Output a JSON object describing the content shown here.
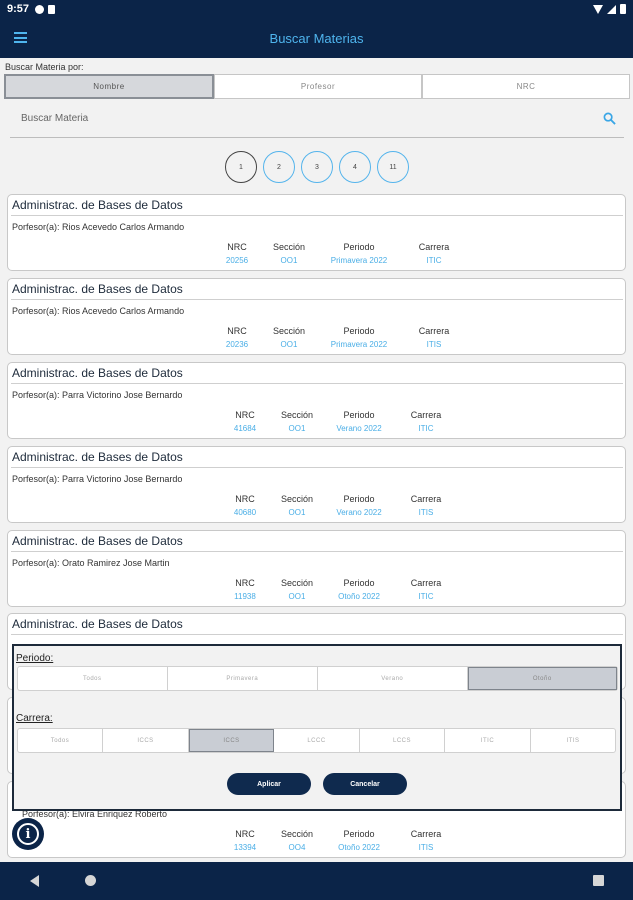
{
  "status": {
    "time": "9:57"
  },
  "appbar": {
    "title": "Buscar Materias"
  },
  "search": {
    "by_label": "Buscar Materia por:",
    "options": [
      "Nombre",
      "Profesor",
      "NRC"
    ],
    "placeholder": "Buscar Materia"
  },
  "pagination": [
    "1",
    "2",
    "3",
    "4",
    "11"
  ],
  "cards": [
    {
      "title": "Administrac. de Bases de Datos",
      "prof": "Porfesor(a): Rios Acevedo Carlos Armando",
      "h_nrc": "NRC",
      "h_seccion": "Sección",
      "h_periodo": "Periodo",
      "h_carrera": "Carrera",
      "nrc": "20256",
      "seccion": "OO1",
      "periodo": "Primavera 2022",
      "carrera": "ITIC"
    },
    {
      "title": "Administrac. de Bases de Datos",
      "prof": "Porfesor(a): Rios Acevedo Carlos Armando",
      "h_nrc": "NRC",
      "h_seccion": "Sección",
      "h_periodo": "Periodo",
      "h_carrera": "Carrera",
      "nrc": "20236",
      "seccion": "OO1",
      "periodo": "Primavera 2022",
      "carrera": "ITIS"
    },
    {
      "title": "Administrac. de Bases de Datos",
      "prof": "Porfesor(a): Parra Victorino Jose Bernardo",
      "h_nrc": "NRC",
      "h_seccion": "Sección",
      "h_periodo": "Periodo",
      "h_carrera": "Carrera",
      "nrc": "41684",
      "seccion": "OO1",
      "periodo": "Verano 2022",
      "carrera": "ITIC"
    },
    {
      "title": "Administrac. de Bases de Datos",
      "prof": "Porfesor(a): Parra Victorino Jose Bernardo",
      "h_nrc": "NRC",
      "h_seccion": "Sección",
      "h_periodo": "Periodo",
      "h_carrera": "Carrera",
      "nrc": "40680",
      "seccion": "OO1",
      "periodo": "Verano 2022",
      "carrera": "ITIS"
    },
    {
      "title": "Administrac. de Bases de Datos",
      "prof": "Porfesor(a): Orato Ramirez Jose Martin",
      "h_nrc": "NRC",
      "h_seccion": "Sección",
      "h_periodo": "Periodo",
      "h_carrera": "Carrera",
      "nrc": "11938",
      "seccion": "OO1",
      "periodo": "Otoño 2022",
      "carrera": "ITIC"
    },
    {
      "title": "Administrac. de Bases de Datos",
      "prof": ""
    },
    {
      "title": "",
      "prof": ""
    },
    {
      "title": "",
      "prof": "Porfesor(a): Elvira Enriquez Roberto",
      "h_nrc": "NRC",
      "h_seccion": "Sección",
      "h_periodo": "Periodo",
      "h_carrera": "Carrera",
      "nrc": "13394",
      "seccion": "OO4",
      "periodo": "Otoño 2022",
      "carrera": "ITIS"
    }
  ],
  "filter": {
    "periodo_label": "Periodo:",
    "periodos": [
      "Todos",
      "Primavera",
      "Verano",
      "Otoño"
    ],
    "carrera_label": "Carrera:",
    "carreras": [
      "Todos",
      "ICCS",
      "ICCS",
      "LCCC",
      "LCCS",
      "ITIC",
      "ITIS"
    ],
    "apply": "Aplicar",
    "cancel": "Cancelar"
  }
}
